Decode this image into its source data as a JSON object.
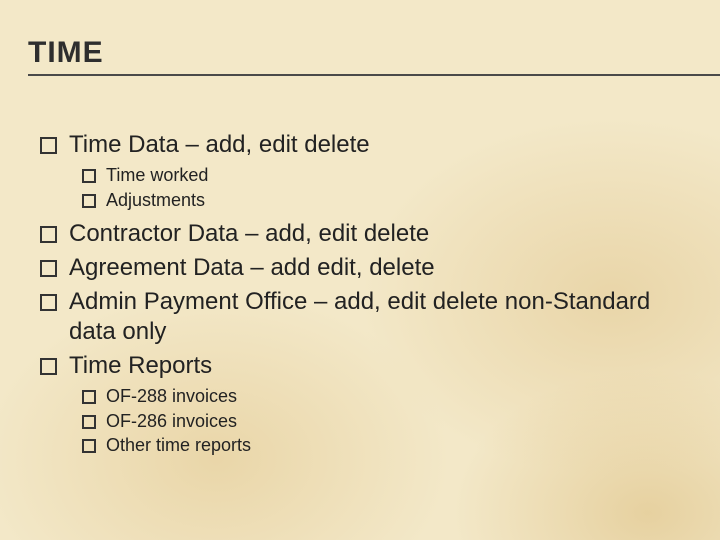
{
  "title": "TIME",
  "items": {
    "time_data": "Time Data – add, edit delete",
    "time_worked": "Time worked",
    "adjustments": "Adjustments",
    "contractor_data": "Contractor Data – add, edit delete",
    "agreement_data": "Agreement Data – add edit, delete",
    "admin_payment": "Admin Payment Office – add, edit delete non-Standard data only",
    "time_reports": "Time Reports",
    "of288": "OF-288 invoices",
    "of286": "OF-286 invoices",
    "other_reports": "Other time reports"
  }
}
